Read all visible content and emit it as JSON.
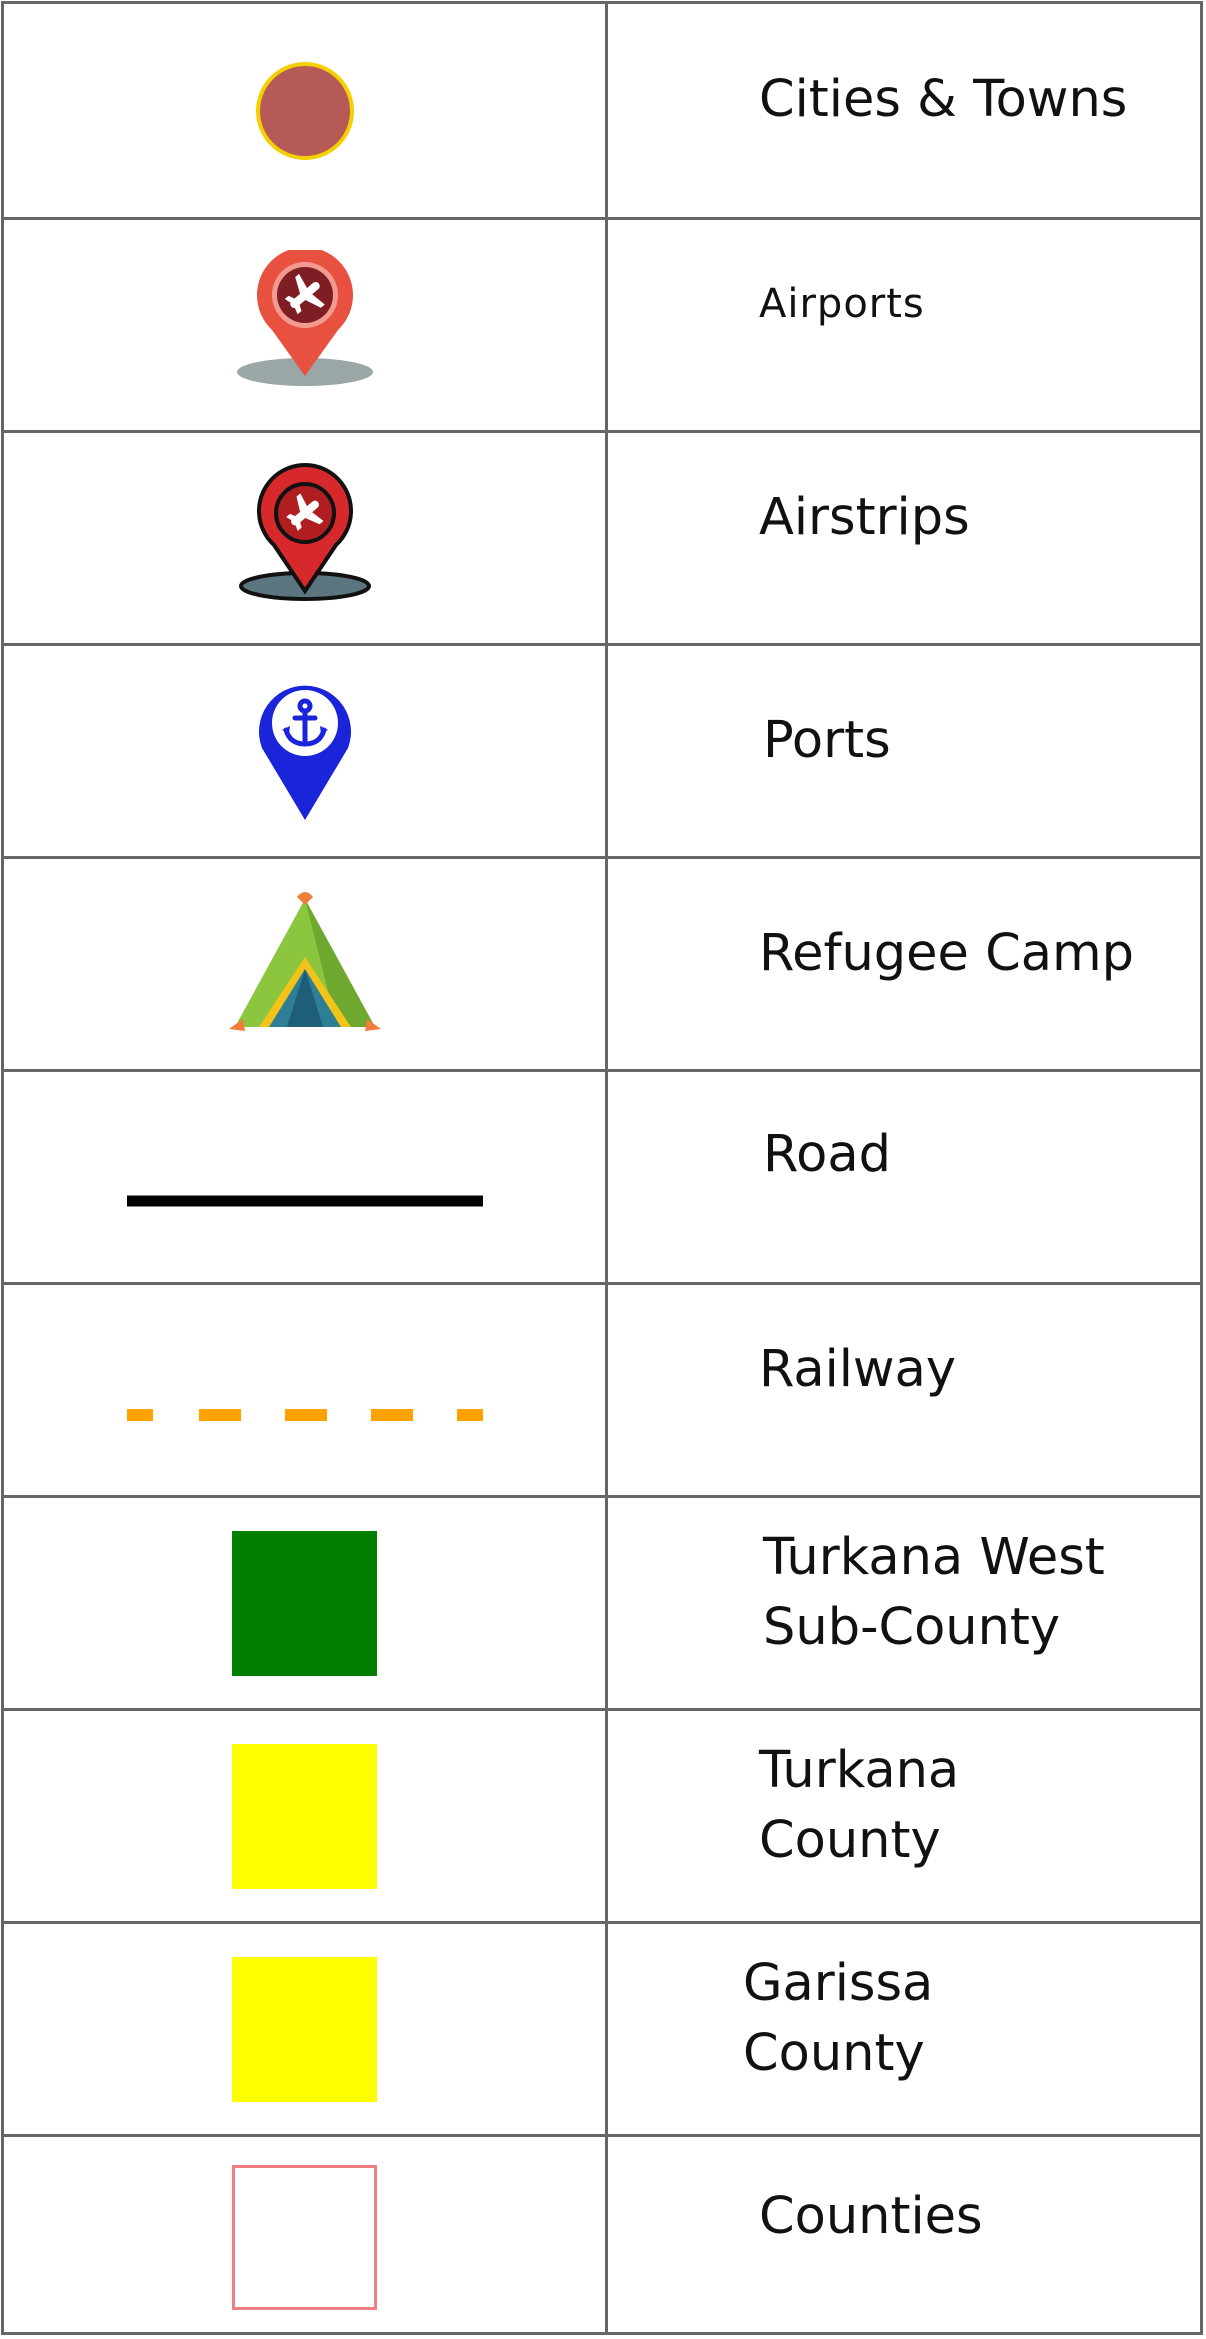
{
  "legend": {
    "items": [
      {
        "label": "Cities & Towns",
        "icon": "city-dot-icon",
        "color": "#B55A57",
        "stroke": "#F5D000"
      },
      {
        "label": "Airports",
        "icon": "airport-pin-icon",
        "color": "#E8503F"
      },
      {
        "label": "Airstrips",
        "icon": "airstrip-pin-icon",
        "color": "#D7282B"
      },
      {
        "label": "Ports",
        "icon": "port-anchor-pin-icon",
        "color": "#1A24D8"
      },
      {
        "label": "Refugee Camp",
        "icon": "tent-icon",
        "color": "#8CC63F"
      },
      {
        "label": "Road",
        "icon": "road-line-icon",
        "color": "#000000"
      },
      {
        "label": "Railway",
        "icon": "railway-dashed-line-icon",
        "color": "#FFA200"
      },
      {
        "label_lines": [
          "Turkana West",
          "Sub-County"
        ],
        "icon": "fill-square-icon",
        "color": "#007F00"
      },
      {
        "label_lines": [
          "Turkana",
          "County"
        ],
        "icon": "fill-square-icon",
        "color": "#FFFF00"
      },
      {
        "label_lines": [
          "Garissa",
          "County"
        ],
        "icon": "fill-square-icon",
        "color": "#FFFF00"
      },
      {
        "label": "Counties",
        "icon": "outline-square-icon",
        "color": "#F08080"
      }
    ]
  }
}
